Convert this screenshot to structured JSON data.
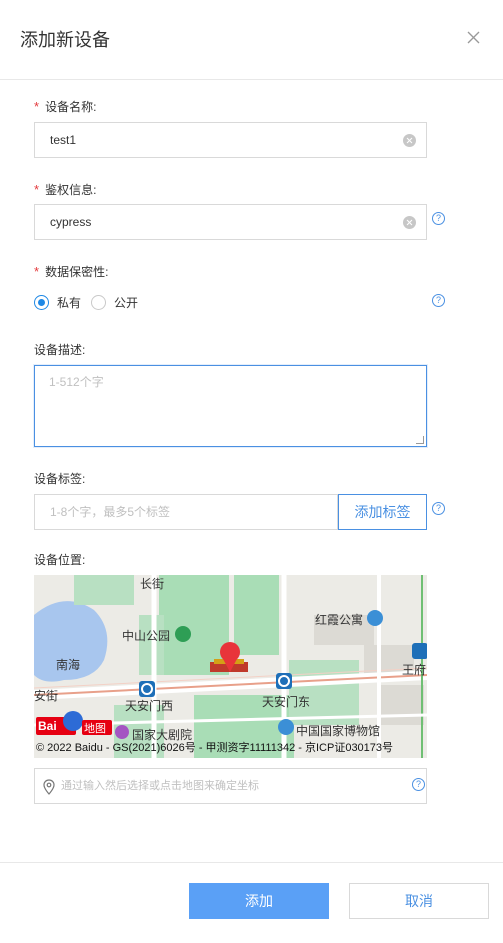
{
  "dialog": {
    "title": "添加新设备"
  },
  "form": {
    "name": {
      "required_mark": "*",
      "label": "设备名称:",
      "value": "test1"
    },
    "auth": {
      "required_mark": "*",
      "label": "鉴权信息:",
      "value": "cypress"
    },
    "privacy": {
      "required_mark": "*",
      "label": "数据保密性:",
      "options": [
        "私有",
        "公开"
      ],
      "selected": "私有"
    },
    "description": {
      "label": "设备描述:",
      "placeholder": "1-512个字"
    },
    "tags": {
      "label": "设备标签:",
      "placeholder": "1-8个字，最多5个标签",
      "add_button": "添加标签"
    },
    "location": {
      "label": "设备位置:",
      "placeholder": "通过输入然后选择或点击地图来确定坐标"
    },
    "help_glyph": "?"
  },
  "map": {
    "labels": {
      "chang_jie": "长街",
      "zhongshan_park": "中山公园",
      "hongxia": "红霞公寓",
      "nanhai": "南海",
      "anjie": "安街",
      "tiananmen_west": "天安门西",
      "tiananmen_east": "天安门东",
      "wangfu": "王府",
      "museum": "中国国家博物馆",
      "theatre": "国家大剧院"
    },
    "logo_text_1": "Bai",
    "logo_text_2": "地图",
    "copyright": "© 2022 Baidu - GS(2021)6026号 - 甲测资字11111342 - 京ICP证030173号",
    "colors": {
      "water": "#a8c6ee",
      "park": "#a9ddb6",
      "road": "#ffffff",
      "main_road": "#e8a08a",
      "marker": "#e8343a"
    }
  },
  "footer": {
    "submit": "添加",
    "cancel": "取消"
  },
  "colors": {
    "primary": "#5aa0f6",
    "accent": "#4a90e2",
    "required": "#e4393c"
  }
}
